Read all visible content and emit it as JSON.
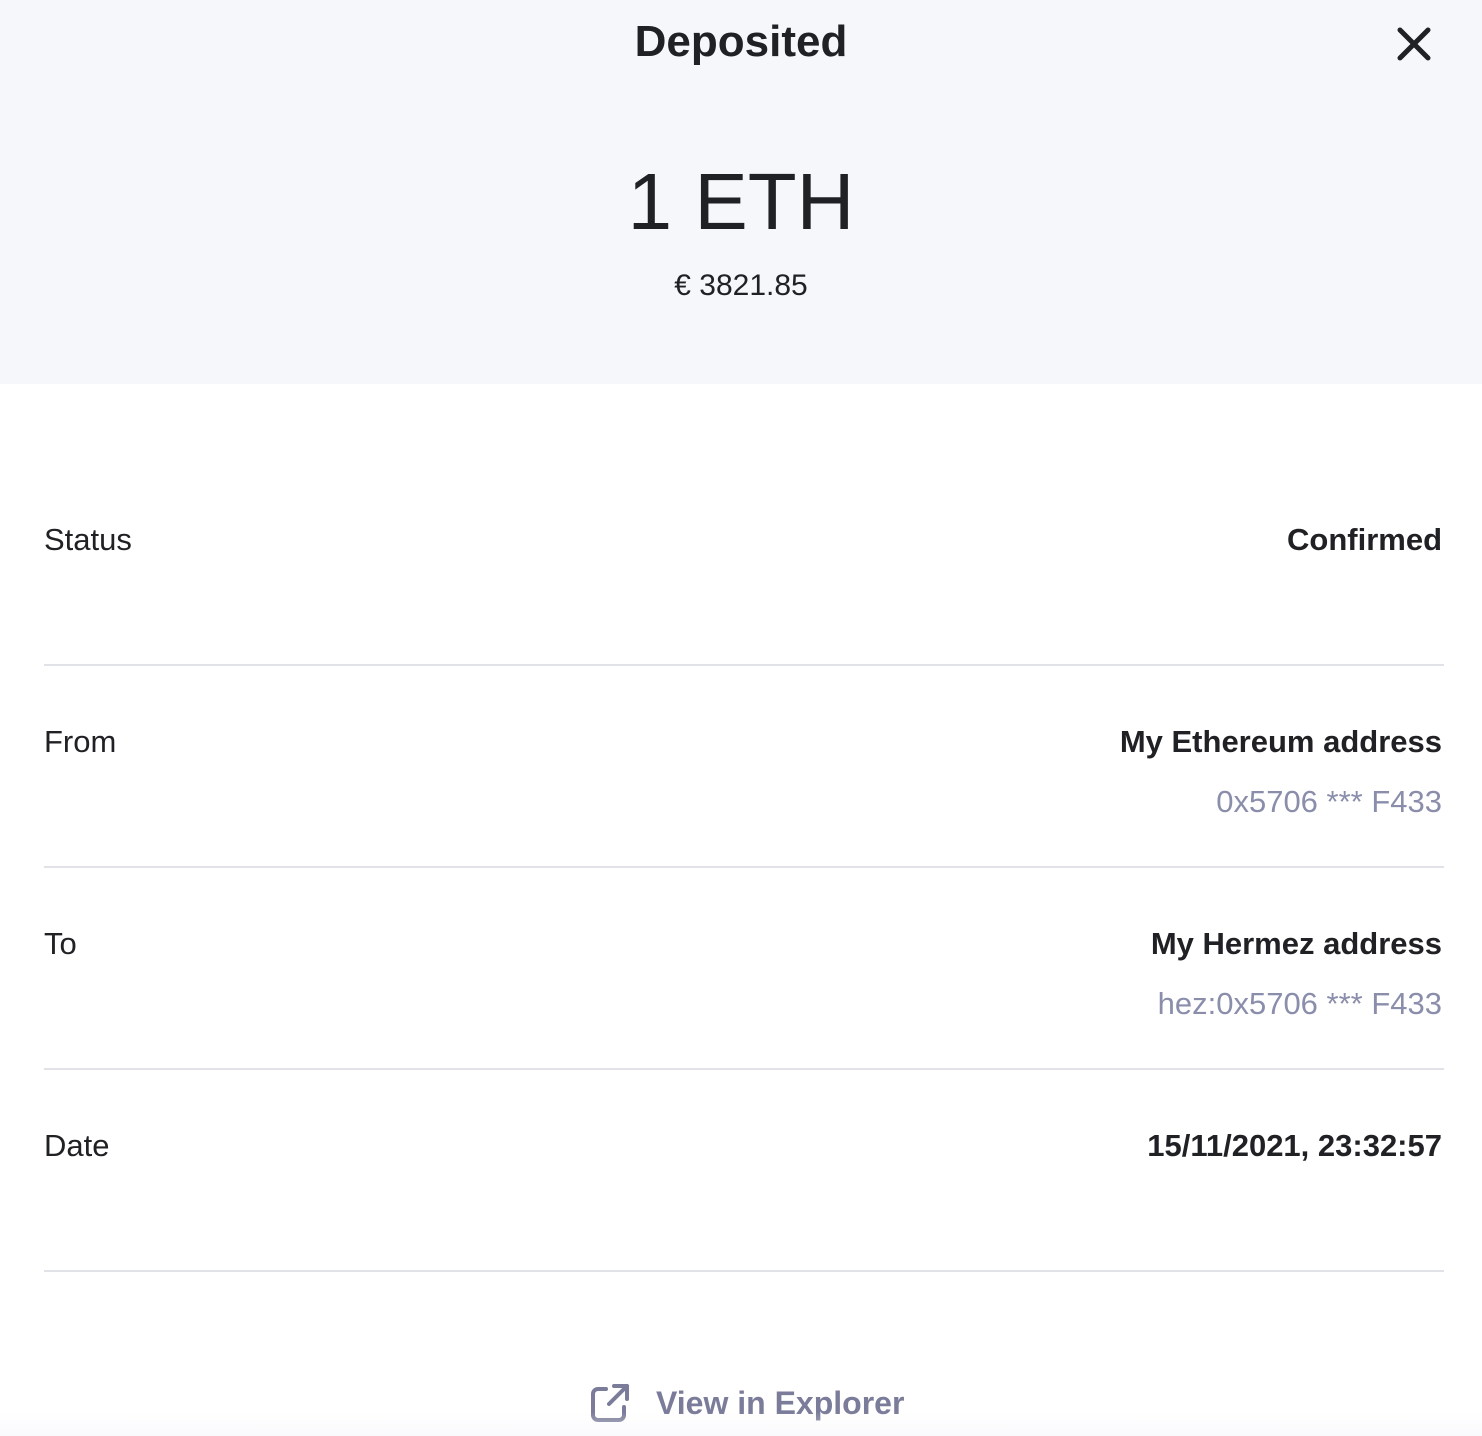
{
  "header": {
    "title": "Deposited",
    "amount": "1 ETH",
    "fiat_value": "€ 3821.85"
  },
  "details": {
    "status": {
      "label": "Status",
      "value": "Confirmed"
    },
    "from": {
      "label": "From",
      "value": "My Ethereum address",
      "address": "0x5706 *** F433"
    },
    "to": {
      "label": "To",
      "value": "My Hermez address",
      "address": "hez:0x5706 *** F433"
    },
    "date": {
      "label": "Date",
      "value": "15/11/2021, 23:32:57"
    }
  },
  "footer": {
    "explorer_label": "View in Explorer"
  },
  "icons": {
    "close": "close-icon",
    "external_link": "external-link-icon"
  },
  "colors": {
    "header_bg": "#f6f7fa",
    "text": "#202124",
    "secondary": "#8a8eab",
    "link": "#7a7c99",
    "divider": "#e1e2e8"
  }
}
